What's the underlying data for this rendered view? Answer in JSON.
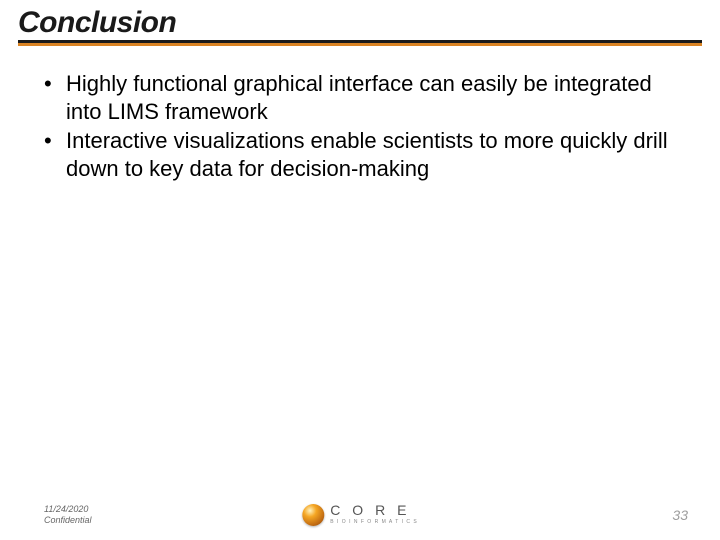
{
  "title": "Conclusion",
  "bullets": [
    "Highly functional graphical interface can easily be integrated into LIMS framework",
    "Interactive visualizations enable scientists to more quickly drill down to key data for decision-making"
  ],
  "footer": {
    "date": "11/24/2020",
    "confidential": "Confidential",
    "logo_word": "C O R E",
    "logo_sub": "B I O I N F O R M A T I C S",
    "page": "33"
  }
}
